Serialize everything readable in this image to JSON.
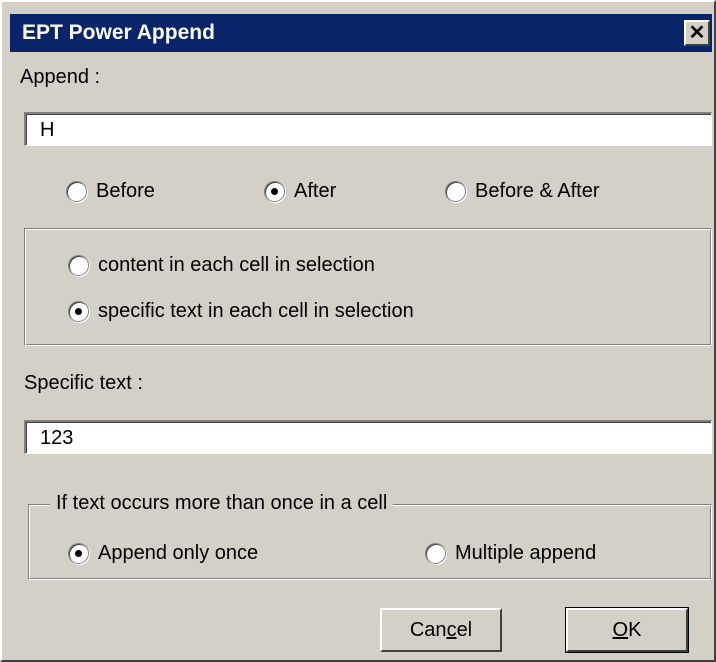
{
  "dialog": {
    "title": "EPT Power Append",
    "close_glyph": "✕"
  },
  "append": {
    "label": "Append :",
    "value": "H"
  },
  "position_options": [
    {
      "label": "Before",
      "selected": false
    },
    {
      "label": "After",
      "selected": true
    },
    {
      "label": "Before & After",
      "selected": false
    }
  ],
  "target_options": [
    {
      "label": "content in each cell in selection",
      "selected": false
    },
    {
      "label": "specific text in each cell in selection",
      "selected": true
    }
  ],
  "specific_text": {
    "label": "Specific text :",
    "value": "123"
  },
  "occurrence": {
    "legend": "If text occurs more than once in a cell",
    "options": [
      {
        "label": "Append only once",
        "selected": true
      },
      {
        "label": "Multiple append",
        "selected": false
      }
    ]
  },
  "buttons": {
    "cancel": {
      "before": "Can",
      "accel": "c",
      "after": "el"
    },
    "ok": {
      "before": "",
      "accel": "O",
      "after": "K"
    }
  }
}
